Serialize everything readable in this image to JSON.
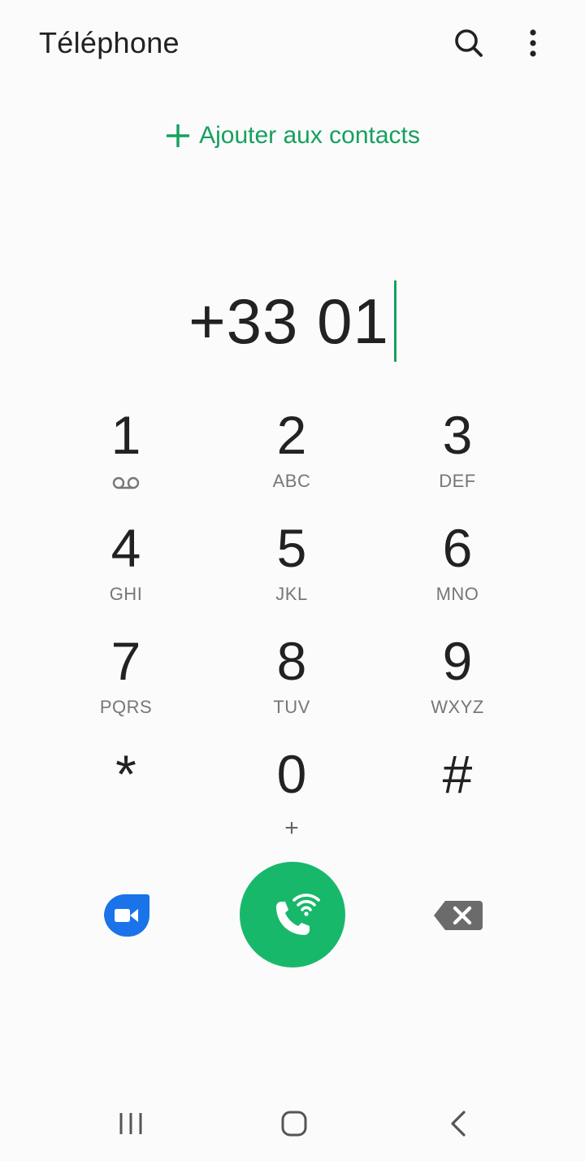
{
  "header": {
    "title": "Téléphone",
    "search_icon": "search-icon",
    "more_icon": "more-vertical-icon"
  },
  "add_contact": {
    "label": "Ajouter aux contacts",
    "icon": "plus-icon"
  },
  "dial_display": {
    "number": "+33 01"
  },
  "keypad": {
    "keys": [
      {
        "digit": "1",
        "letters": "",
        "sub_icon": "voicemail-icon"
      },
      {
        "digit": "2",
        "letters": "ABC"
      },
      {
        "digit": "3",
        "letters": "DEF"
      },
      {
        "digit": "4",
        "letters": "GHI"
      },
      {
        "digit": "5",
        "letters": "JKL"
      },
      {
        "digit": "6",
        "letters": "MNO"
      },
      {
        "digit": "7",
        "letters": "PQRS"
      },
      {
        "digit": "8",
        "letters": "TUV"
      },
      {
        "digit": "9",
        "letters": "WXYZ"
      },
      {
        "digit": "*",
        "letters": ""
      },
      {
        "digit": "0",
        "letters": "+"
      },
      {
        "digit": "#",
        "letters": ""
      }
    ]
  },
  "actions": {
    "video_icon": "video-call-icon",
    "call_icon": "wifi-call-icon",
    "backspace_icon": "backspace-icon"
  },
  "colors": {
    "accent": "#16a05e",
    "call_button": "#18b86b",
    "video_blue": "#1a73e8",
    "backspace_gray": "#6b6b6b"
  },
  "navbar": {
    "recents_icon": "recent-apps-icon",
    "home_icon": "home-icon",
    "back_icon": "back-icon"
  }
}
